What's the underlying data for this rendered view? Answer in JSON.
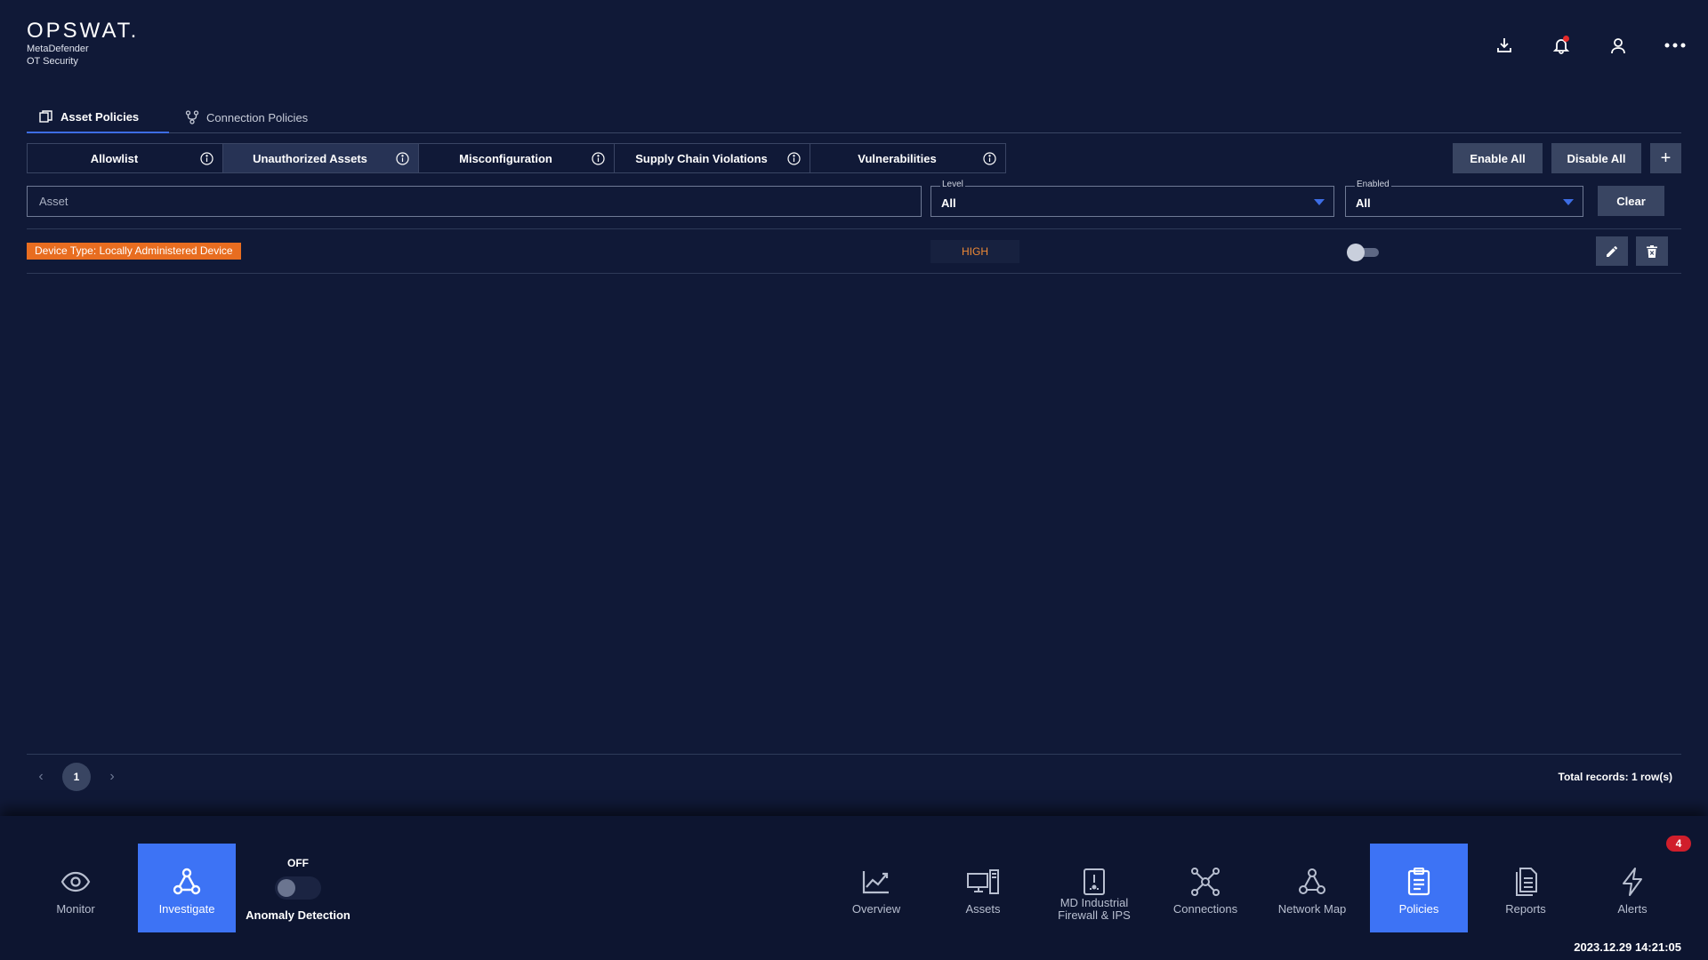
{
  "brand": {
    "logo": "OPSWAT.",
    "product_line1": "MetaDefender",
    "product_line2": "OT Security"
  },
  "header_icons": [
    "download-icon",
    "bell-icon",
    "user-icon",
    "more-icon"
  ],
  "main_tabs": [
    {
      "label": "Asset Policies",
      "icon": "asset-policies-icon",
      "active": true
    },
    {
      "label": "Connection Policies",
      "icon": "connection-policies-icon",
      "active": false
    }
  ],
  "sub_tabs": [
    {
      "label": "Allowlist",
      "active": false
    },
    {
      "label": "Unauthorized Assets",
      "active": true
    },
    {
      "label": "Misconfiguration",
      "active": false
    },
    {
      "label": "Supply Chain Violations",
      "active": false
    },
    {
      "label": "Vulnerabilities",
      "active": false
    }
  ],
  "actions": {
    "enable_all": "Enable All",
    "disable_all": "Disable All",
    "add": "+"
  },
  "filters": {
    "asset_placeholder": "Asset",
    "asset_value": "",
    "level_label": "Level",
    "level_value": "All",
    "enabled_label": "Enabled",
    "enabled_value": "All",
    "clear": "Clear"
  },
  "rows": [
    {
      "asset": "Device Type: Locally Administered Device",
      "level": "HIGH",
      "enabled": false
    }
  ],
  "pagination": {
    "current_page": "1",
    "total_records": "Total records: 1 row(s)"
  },
  "bottom_nav": {
    "monitor": "Monitor",
    "investigate": "Investigate",
    "anomaly_state": "OFF",
    "anomaly_label": "Anomaly Detection",
    "overview": "Overview",
    "assets": "Assets",
    "firewall_line1": "MD Industrial",
    "firewall_line2": "Firewall & IPS",
    "connections": "Connections",
    "network_map": "Network Map",
    "policies": "Policies",
    "reports": "Reports",
    "alerts": "Alerts",
    "alerts_count": "4"
  },
  "timestamp": "2023.12.29 14:21:05",
  "colors": {
    "background": "#101937",
    "accent": "#3d73f5",
    "badge_orange": "#e86d20",
    "level_high": "#f08a35",
    "alert_red": "#d01e2b"
  }
}
